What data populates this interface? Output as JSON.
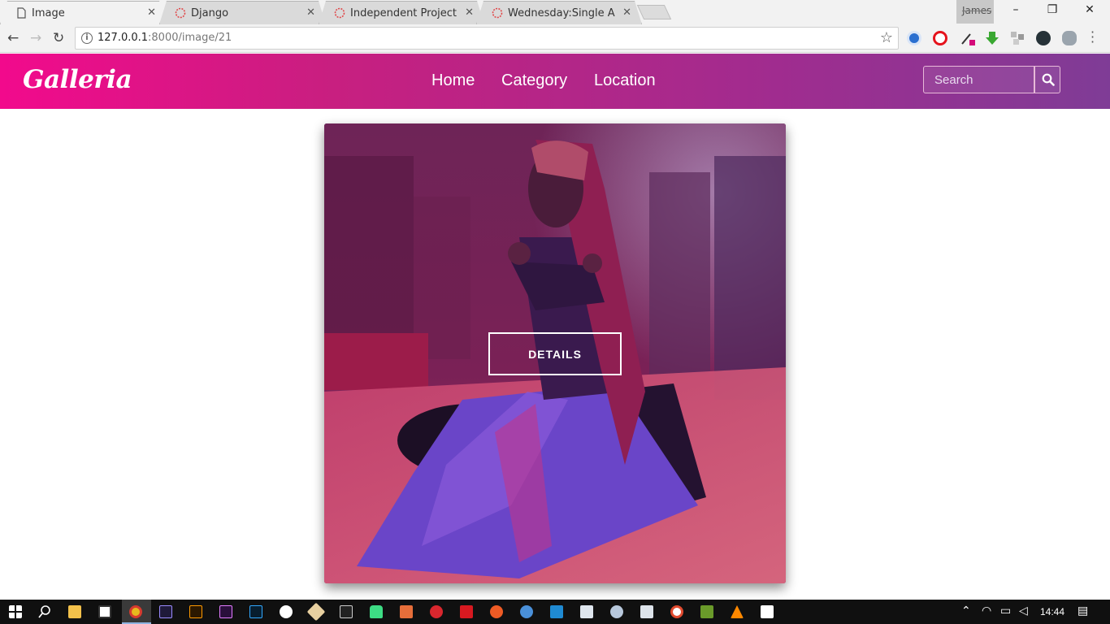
{
  "browser": {
    "tabs": [
      {
        "title": "Image",
        "icon": "page-icon",
        "active": true
      },
      {
        "title": "Django",
        "icon": "loading-icon",
        "active": false
      },
      {
        "title": "Independent Project",
        "icon": "loading-icon",
        "active": false
      },
      {
        "title": "Wednesday:Single Article",
        "icon": "loading-icon",
        "active": false
      }
    ],
    "profile_name": "James",
    "window_controls": {
      "minimize": "–",
      "restore": "❐",
      "close": "✕"
    },
    "url_host": "127.0.0.1",
    "url_path": ":8000/image/21",
    "nav": {
      "back": "←",
      "forward": "→",
      "reload": "↻"
    },
    "bookmark_icon": "☆",
    "extension_icons": [
      "globe-icon",
      "opera-icon",
      "eyedropper-icon",
      "download-icon",
      "grid-icon",
      "zeta-icon",
      "cloud-icon"
    ]
  },
  "site": {
    "brand": "Galleria",
    "nav": {
      "home": "Home",
      "category": "Category",
      "location": "Location"
    },
    "search_placeholder": "Search",
    "colors": {
      "gradient_start": "#f20a8c",
      "gradient_end": "#7f3c96"
    }
  },
  "card": {
    "details_label": "DETAILS",
    "overlay_color": "#8a1a5e"
  },
  "taskbar": {
    "time": "14:44",
    "apps": [
      "windows-start-icon",
      "search-icon",
      "file-explorer-icon",
      "store-icon",
      "chrome-icon",
      "after-effects-icon",
      "illustrator-icon",
      "premiere-icon",
      "photoshop-icon",
      "settings-icon",
      "git-icon",
      "terminal-icon",
      "android-icon",
      "sublime-icon",
      "mega-icon",
      "acrobat-icon",
      "postman-icon",
      "github-icon",
      "vscode-icon",
      "virtualbox-icon",
      "postgres-icon",
      "dashboard-icon",
      "paint-icon",
      "games-icon",
      "vlc-icon",
      "photos-icon"
    ]
  }
}
